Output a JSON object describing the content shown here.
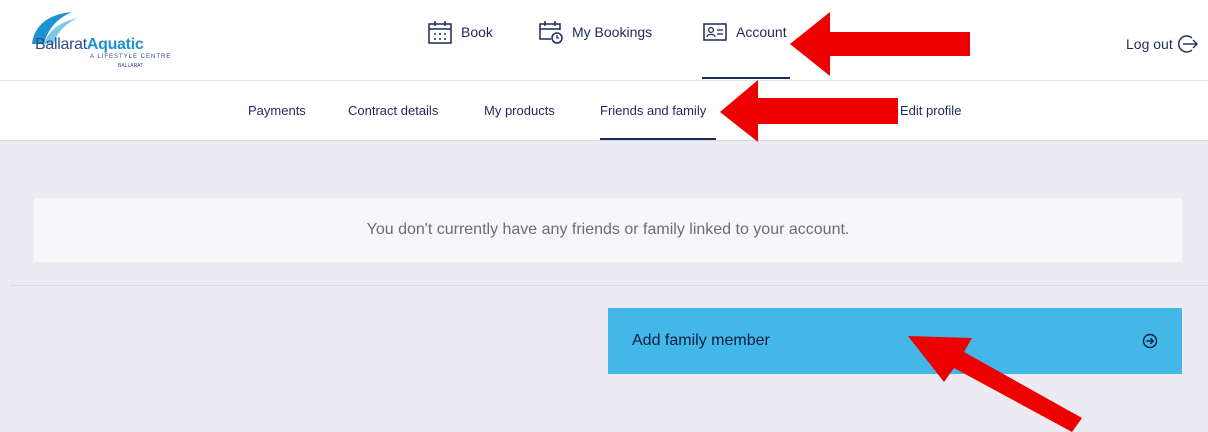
{
  "brand": {
    "name_part1": "Ballarat",
    "name_part2": "Aquatic",
    "tagline": "A LIFESTYLE CENTRE",
    "city": "BALLARAT"
  },
  "main_nav": [
    {
      "label": "Book",
      "icon": "calendar-icon"
    },
    {
      "label": "My Bookings",
      "icon": "calendar-clock-icon"
    },
    {
      "label": "Account",
      "icon": "id-card-icon",
      "active": true
    }
  ],
  "logout": {
    "label": "Log out",
    "icon": "logout-arrow-icon"
  },
  "sub_nav": [
    {
      "label": "Payments"
    },
    {
      "label": "Contract details"
    },
    {
      "label": "My products"
    },
    {
      "label": "Friends and family",
      "active": true
    },
    {
      "label": "Edit profile"
    }
  ],
  "main": {
    "empty_message": "You don't currently have any friends or family linked to your account.",
    "add_button_label": "Add family member",
    "add_button_icon": "arrow-circle-right-icon"
  },
  "colors": {
    "accent": "#43b7e8",
    "nav_text": "#1d2a5c",
    "annotation_arrow": "#ee0000",
    "background": "#ecebf3"
  }
}
